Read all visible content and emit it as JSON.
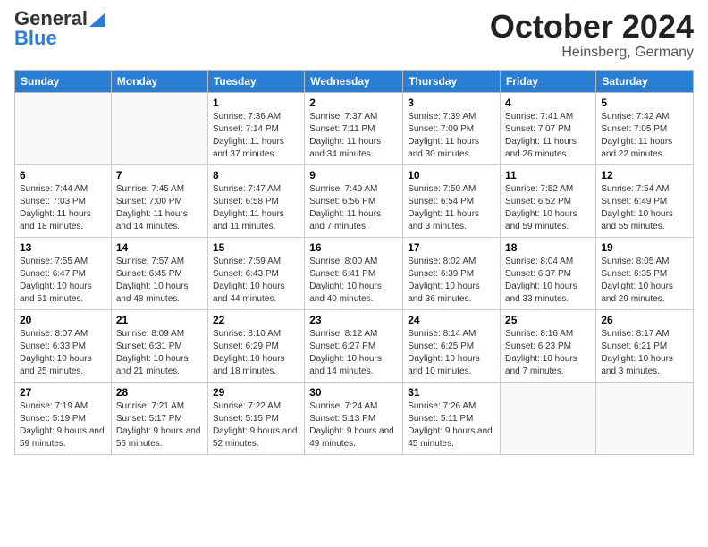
{
  "header": {
    "logo_line1": "General",
    "logo_line2": "Blue",
    "title": "October 2024",
    "subtitle": "Heinsberg, Germany"
  },
  "days_of_week": [
    "Sunday",
    "Monday",
    "Tuesday",
    "Wednesday",
    "Thursday",
    "Friday",
    "Saturday"
  ],
  "weeks": [
    [
      {
        "day": "",
        "sunrise": "",
        "sunset": "",
        "daylight": ""
      },
      {
        "day": "",
        "sunrise": "",
        "sunset": "",
        "daylight": ""
      },
      {
        "day": "1",
        "sunrise": "Sunrise: 7:36 AM",
        "sunset": "Sunset: 7:14 PM",
        "daylight": "Daylight: 11 hours and 37 minutes."
      },
      {
        "day": "2",
        "sunrise": "Sunrise: 7:37 AM",
        "sunset": "Sunset: 7:11 PM",
        "daylight": "Daylight: 11 hours and 34 minutes."
      },
      {
        "day": "3",
        "sunrise": "Sunrise: 7:39 AM",
        "sunset": "Sunset: 7:09 PM",
        "daylight": "Daylight: 11 hours and 30 minutes."
      },
      {
        "day": "4",
        "sunrise": "Sunrise: 7:41 AM",
        "sunset": "Sunset: 7:07 PM",
        "daylight": "Daylight: 11 hours and 26 minutes."
      },
      {
        "day": "5",
        "sunrise": "Sunrise: 7:42 AM",
        "sunset": "Sunset: 7:05 PM",
        "daylight": "Daylight: 11 hours and 22 minutes."
      }
    ],
    [
      {
        "day": "6",
        "sunrise": "Sunrise: 7:44 AM",
        "sunset": "Sunset: 7:03 PM",
        "daylight": "Daylight: 11 hours and 18 minutes."
      },
      {
        "day": "7",
        "sunrise": "Sunrise: 7:45 AM",
        "sunset": "Sunset: 7:00 PM",
        "daylight": "Daylight: 11 hours and 14 minutes."
      },
      {
        "day": "8",
        "sunrise": "Sunrise: 7:47 AM",
        "sunset": "Sunset: 6:58 PM",
        "daylight": "Daylight: 11 hours and 11 minutes."
      },
      {
        "day": "9",
        "sunrise": "Sunrise: 7:49 AM",
        "sunset": "Sunset: 6:56 PM",
        "daylight": "Daylight: 11 hours and 7 minutes."
      },
      {
        "day": "10",
        "sunrise": "Sunrise: 7:50 AM",
        "sunset": "Sunset: 6:54 PM",
        "daylight": "Daylight: 11 hours and 3 minutes."
      },
      {
        "day": "11",
        "sunrise": "Sunrise: 7:52 AM",
        "sunset": "Sunset: 6:52 PM",
        "daylight": "Daylight: 10 hours and 59 minutes."
      },
      {
        "day": "12",
        "sunrise": "Sunrise: 7:54 AM",
        "sunset": "Sunset: 6:49 PM",
        "daylight": "Daylight: 10 hours and 55 minutes."
      }
    ],
    [
      {
        "day": "13",
        "sunrise": "Sunrise: 7:55 AM",
        "sunset": "Sunset: 6:47 PM",
        "daylight": "Daylight: 10 hours and 51 minutes."
      },
      {
        "day": "14",
        "sunrise": "Sunrise: 7:57 AM",
        "sunset": "Sunset: 6:45 PM",
        "daylight": "Daylight: 10 hours and 48 minutes."
      },
      {
        "day": "15",
        "sunrise": "Sunrise: 7:59 AM",
        "sunset": "Sunset: 6:43 PM",
        "daylight": "Daylight: 10 hours and 44 minutes."
      },
      {
        "day": "16",
        "sunrise": "Sunrise: 8:00 AM",
        "sunset": "Sunset: 6:41 PM",
        "daylight": "Daylight: 10 hours and 40 minutes."
      },
      {
        "day": "17",
        "sunrise": "Sunrise: 8:02 AM",
        "sunset": "Sunset: 6:39 PM",
        "daylight": "Daylight: 10 hours and 36 minutes."
      },
      {
        "day": "18",
        "sunrise": "Sunrise: 8:04 AM",
        "sunset": "Sunset: 6:37 PM",
        "daylight": "Daylight: 10 hours and 33 minutes."
      },
      {
        "day": "19",
        "sunrise": "Sunrise: 8:05 AM",
        "sunset": "Sunset: 6:35 PM",
        "daylight": "Daylight: 10 hours and 29 minutes."
      }
    ],
    [
      {
        "day": "20",
        "sunrise": "Sunrise: 8:07 AM",
        "sunset": "Sunset: 6:33 PM",
        "daylight": "Daylight: 10 hours and 25 minutes."
      },
      {
        "day": "21",
        "sunrise": "Sunrise: 8:09 AM",
        "sunset": "Sunset: 6:31 PM",
        "daylight": "Daylight: 10 hours and 21 minutes."
      },
      {
        "day": "22",
        "sunrise": "Sunrise: 8:10 AM",
        "sunset": "Sunset: 6:29 PM",
        "daylight": "Daylight: 10 hours and 18 minutes."
      },
      {
        "day": "23",
        "sunrise": "Sunrise: 8:12 AM",
        "sunset": "Sunset: 6:27 PM",
        "daylight": "Daylight: 10 hours and 14 minutes."
      },
      {
        "day": "24",
        "sunrise": "Sunrise: 8:14 AM",
        "sunset": "Sunset: 6:25 PM",
        "daylight": "Daylight: 10 hours and 10 minutes."
      },
      {
        "day": "25",
        "sunrise": "Sunrise: 8:16 AM",
        "sunset": "Sunset: 6:23 PM",
        "daylight": "Daylight: 10 hours and 7 minutes."
      },
      {
        "day": "26",
        "sunrise": "Sunrise: 8:17 AM",
        "sunset": "Sunset: 6:21 PM",
        "daylight": "Daylight: 10 hours and 3 minutes."
      }
    ],
    [
      {
        "day": "27",
        "sunrise": "Sunrise: 7:19 AM",
        "sunset": "Sunset: 5:19 PM",
        "daylight": "Daylight: 9 hours and 59 minutes."
      },
      {
        "day": "28",
        "sunrise": "Sunrise: 7:21 AM",
        "sunset": "Sunset: 5:17 PM",
        "daylight": "Daylight: 9 hours and 56 minutes."
      },
      {
        "day": "29",
        "sunrise": "Sunrise: 7:22 AM",
        "sunset": "Sunset: 5:15 PM",
        "daylight": "Daylight: 9 hours and 52 minutes."
      },
      {
        "day": "30",
        "sunrise": "Sunrise: 7:24 AM",
        "sunset": "Sunset: 5:13 PM",
        "daylight": "Daylight: 9 hours and 49 minutes."
      },
      {
        "day": "31",
        "sunrise": "Sunrise: 7:26 AM",
        "sunset": "Sunset: 5:11 PM",
        "daylight": "Daylight: 9 hours and 45 minutes."
      },
      {
        "day": "",
        "sunrise": "",
        "sunset": "",
        "daylight": ""
      },
      {
        "day": "",
        "sunrise": "",
        "sunset": "",
        "daylight": ""
      }
    ]
  ]
}
